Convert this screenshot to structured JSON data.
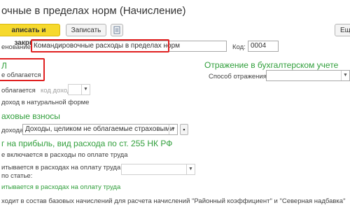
{
  "window": {
    "title": "очные в пределах норм (Начисление)"
  },
  "toolbar": {
    "save_close_label": "аписать и закрыть",
    "save_label": "Записать",
    "more_label": "Ещ"
  },
  "form": {
    "name_label": "енование:",
    "name_value": "Командировочные расходы в пределах норм",
    "code_label": "Код:",
    "code_value": "0004"
  },
  "ndfl": {
    "header": "Л",
    "status_text": "е облагается",
    "taxed_label": "облагается",
    "income_code_label": "код дохода:",
    "natural_form_label": "доход в натуральной форме"
  },
  "insurance": {
    "header": "аховые взносы",
    "income_label": "дохода:",
    "income_value": "Доходы, целиком не облагаемые страховыми взносами"
  },
  "profit_tax": {
    "header": "г на прибыль, вид расхода по ст. 255 НК РФ",
    "not_included_label": "е включается в расходы по оплате труда",
    "counted_label": "итывается в расходах на оплату труда",
    "article_label": "по статье:",
    "counted_label_2": "итывается в расходах на оплату труда"
  },
  "accounting": {
    "header": "Отражение в бухгалтерском учете",
    "method_label": "Способ отражения:"
  },
  "footer": {
    "base_text": "ходит в состав базовых начислений для расчета начислений \"Районный коэффициент\" и \"Северная надбавка\""
  }
}
